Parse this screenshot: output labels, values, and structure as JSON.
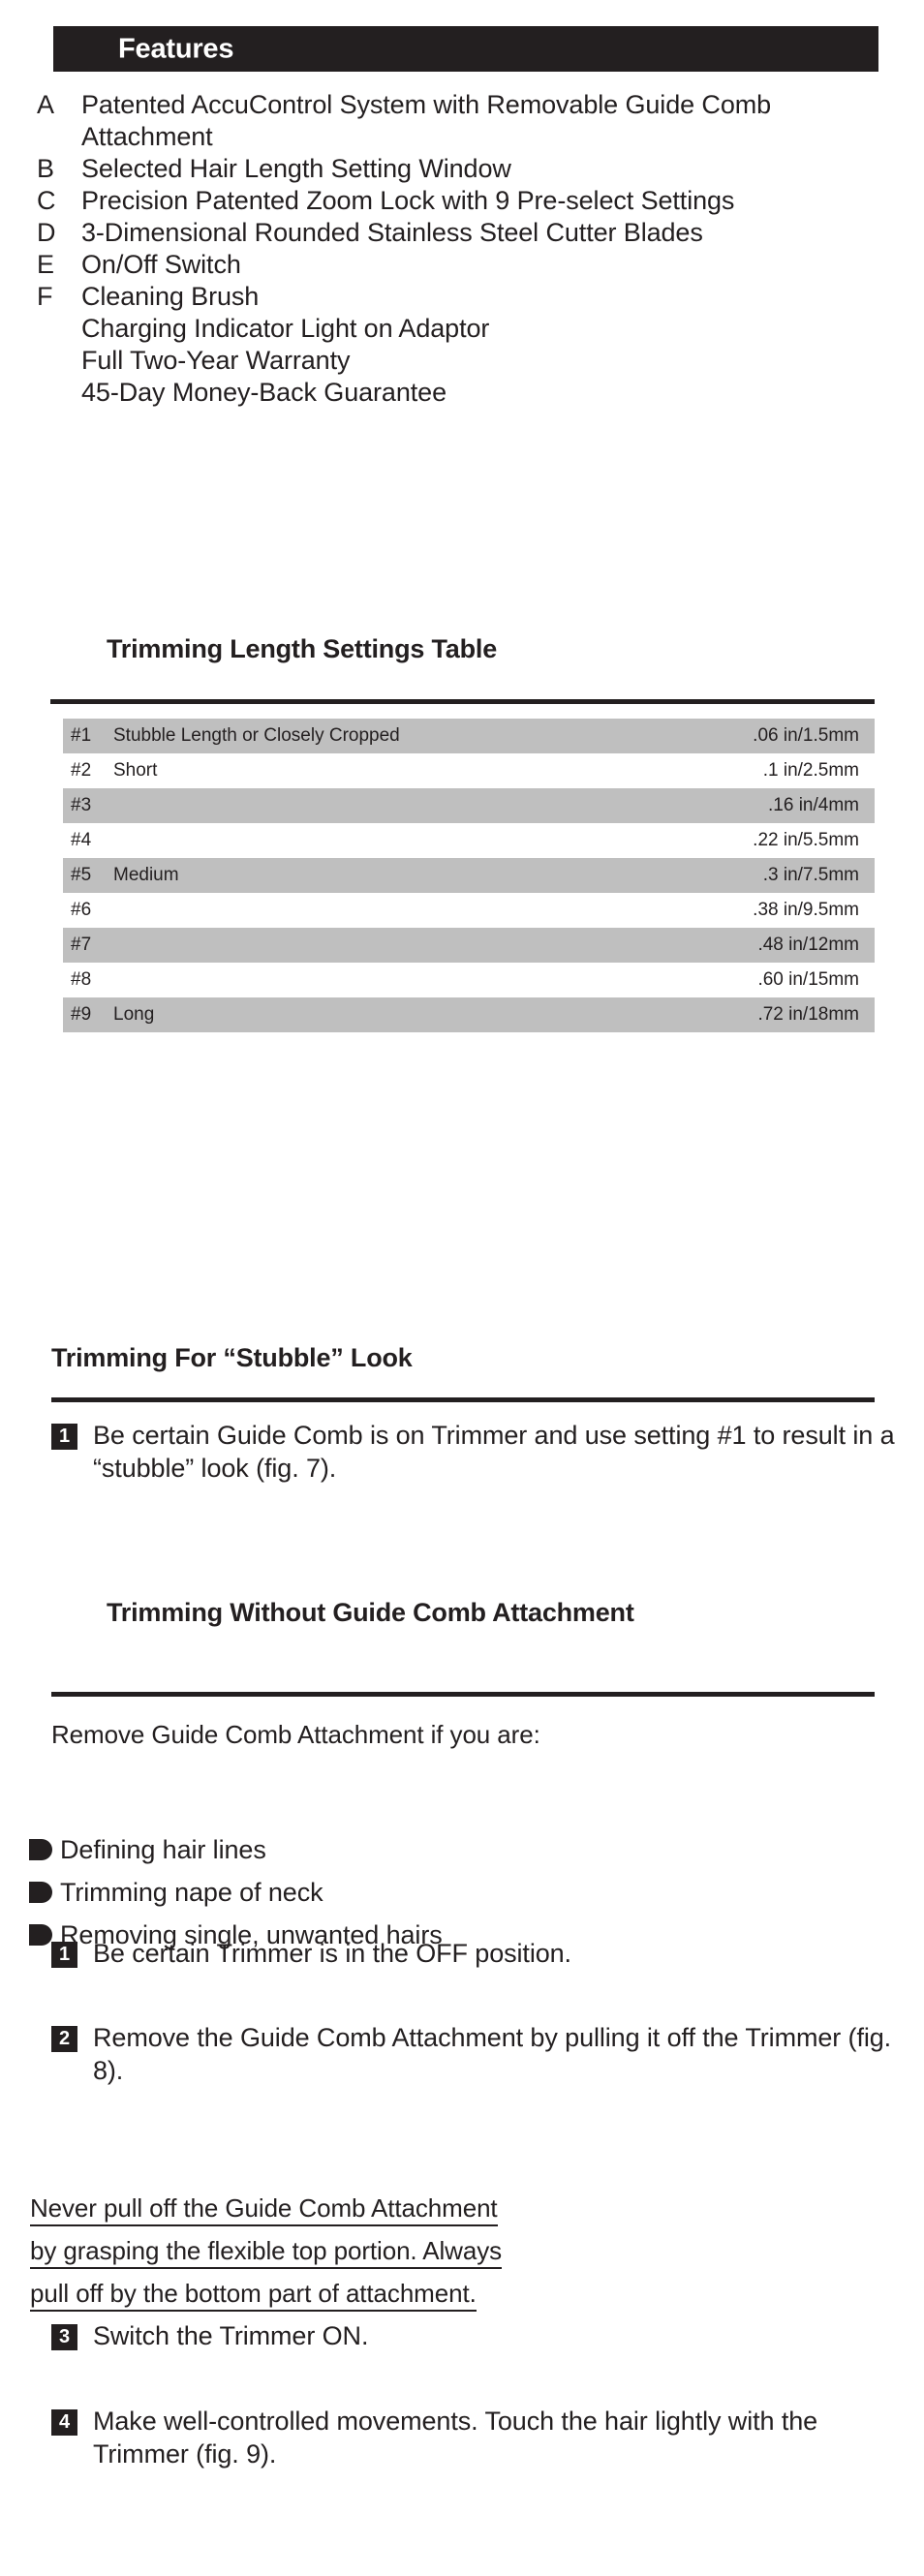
{
  "features": {
    "header_title": "Features",
    "items": [
      {
        "letter": "A",
        "text": "Patented AccuControl System with Removable Guide Comb Attachment"
      },
      {
        "letter": "B",
        "text": "Selected Hair Length Setting Window"
      },
      {
        "letter": "C",
        "text": "Precision Patented Zoom Lock with 9 Pre-select Settings"
      },
      {
        "letter": "D",
        "text": "3-Dimensional Rounded Stainless Steel Cutter Blades"
      },
      {
        "letter": "E",
        "text": "On/Off Switch"
      },
      {
        "letter": "F",
        "text": "Cleaning Brush"
      },
      {
        "letter": "",
        "text": "Charging Indicator Light on Adaptor"
      },
      {
        "letter": "",
        "text": "Full Two-Year Warranty"
      },
      {
        "letter": "",
        "text": "45-Day Money-Back Guarantee"
      }
    ]
  },
  "trimming_table": {
    "title": "Trimming Length Settings Table",
    "rows": [
      {
        "num": "#1",
        "desc": "Stubble Length or Closely Cropped",
        "length": ".06 in/1.5mm",
        "shaded": true
      },
      {
        "num": "#2",
        "desc": "Short",
        "length": ".1 in/2.5mm",
        "shaded": false
      },
      {
        "num": "#3",
        "desc": "",
        "length": ".16 in/4mm",
        "shaded": true
      },
      {
        "num": "#4",
        "desc": "",
        "length": ".22 in/5.5mm",
        "shaded": false
      },
      {
        "num": "#5",
        "desc": "Medium",
        "length": ".3 in/7.5mm",
        "shaded": true
      },
      {
        "num": "#6",
        "desc": "",
        "length": ".38 in/9.5mm",
        "shaded": false
      },
      {
        "num": "#7",
        "desc": "",
        "length": ".48 in/12mm",
        "shaded": true
      },
      {
        "num": "#8",
        "desc": "",
        "length": ".60 in/15mm",
        "shaded": false
      },
      {
        "num": "#9",
        "desc": "Long",
        "length": ".72 in/18mm",
        "shaded": true
      }
    ]
  },
  "stubble_section": {
    "heading": "Trimming For “Stubble” Look",
    "step": {
      "number": "1",
      "text": "Be certain Guide Comb is on Trimmer and use setting #1 to result in a “stubble” look (fig. 7)."
    }
  },
  "without_comb_section": {
    "heading": "Trimming Without Guide Comb Attachment",
    "intro": "Remove Guide Comb Attachment if you are:",
    "bullets": [
      "Defining hair lines",
      "Trimming nape of neck",
      "Removing single, unwanted hairs"
    ],
    "steps": [
      {
        "number": "1",
        "text": "Be certain Trimmer is in the OFF position."
      },
      {
        "number": "2",
        "text": "Remove the Guide Comb Attachment by pulling it off the Trimmer (fig. 8)."
      },
      {
        "number": "3",
        "text": "Switch the Trimmer ON."
      },
      {
        "number": "4",
        "text": "Make well-controlled movements. Touch the hair lightly with the Trimmer (fig. 9)."
      }
    ],
    "warning_lines": [
      "Never pull off the Guide Comb Attachment ",
      "by grasping the flexible top portion. Always ",
      "pull off by the bottom part of attachment."
    ]
  },
  "colors": {
    "ink": "#231f20",
    "table_shade": "#bfbfbf",
    "paper": "#ffffff"
  }
}
